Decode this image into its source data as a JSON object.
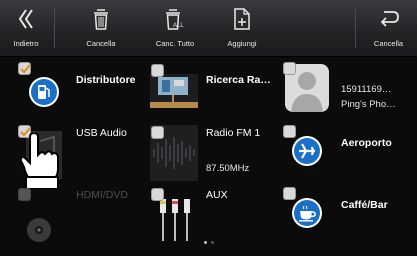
{
  "toolbar": {
    "back_label": "Indietro",
    "delete_label": "Cancella",
    "delete_all_label": "Canc. Tutto",
    "add_label": "Aggiungi",
    "cancel_label": "Cancella"
  },
  "tiles": {
    "distributore": {
      "label": "Distributore",
      "checked": true
    },
    "ricerca": {
      "label": "Ricerca Ra…",
      "checked": false
    },
    "contact": {
      "number": "15911169…",
      "name": "Ping's Pho…",
      "checked": false
    },
    "usb_audio": {
      "label": "USB Audio",
      "checked": true
    },
    "radio": {
      "label": "Radio FM 1",
      "frequency": "87.50MHz",
      "checked": false
    },
    "aeroporto": {
      "label": "Aeroporto",
      "checked": false
    },
    "hdmi": {
      "label": "HDMI/DVD",
      "checked": false
    },
    "aux": {
      "label": "AUX",
      "checked": false
    },
    "caffe": {
      "label": "Caffé/Bar",
      "checked": false
    }
  },
  "pager": {
    "pages": 2,
    "current": 1
  },
  "colors": {
    "accent_blue": "#1a6fc8",
    "toolbar_bg": "#2a2a2e",
    "background": "#0b0b0c"
  }
}
